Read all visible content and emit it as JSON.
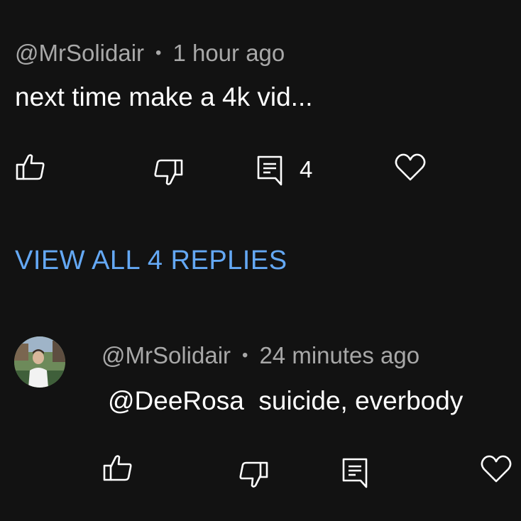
{
  "comment": {
    "author": "@MrSolidair",
    "separator": "•",
    "time": "1 hour ago",
    "text": "next time make a 4k vid...",
    "reply_count": "4",
    "icons": [
      "thumbs-up-icon",
      "thumbs-down-icon",
      "reply-icon",
      "heart-icon"
    ]
  },
  "view_replies_label": "VIEW ALL 4 REPLIES",
  "reply": {
    "author": "@MrSolidair",
    "separator": "•",
    "time": "24 minutes ago",
    "mention": "@DeeRosa",
    "text": "suicide, everbody",
    "icons": [
      "thumbs-up-icon",
      "thumbs-down-icon",
      "reply-icon",
      "heart-icon"
    ]
  },
  "colors": {
    "background": "#121212",
    "meta_text": "#a8a8a8",
    "body_text": "#ffffff",
    "link": "#64a8f4"
  }
}
